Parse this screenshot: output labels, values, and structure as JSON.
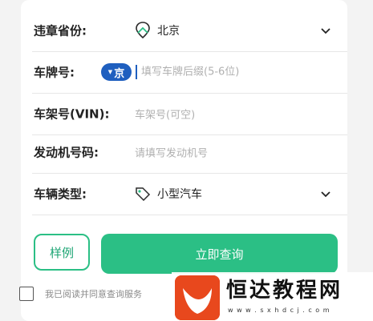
{
  "form": {
    "province": {
      "label": "违章省份:",
      "value": "北京"
    },
    "plate": {
      "label": "车牌号:",
      "prefix": "京",
      "placeholder": "填写车牌后缀(5-6位)"
    },
    "vin": {
      "label": "车架号(VIN):",
      "placeholder": "车架号(可空)"
    },
    "engine": {
      "label": "发动机号码:",
      "placeholder": "请填写发动机号"
    },
    "vehicle_type": {
      "label": "车辆类型:",
      "value": "小型汽车"
    }
  },
  "actions": {
    "sample_label": "样例",
    "query_label": "立即查询"
  },
  "agreement": {
    "text": "我已阅读并同意查询服务"
  },
  "watermark": {
    "title": "恒达教程网",
    "url": "w w w . s x h d c j . c o m"
  },
  "colors": {
    "accent": "#2bbf85",
    "plate_blue": "#1f5fbf"
  }
}
